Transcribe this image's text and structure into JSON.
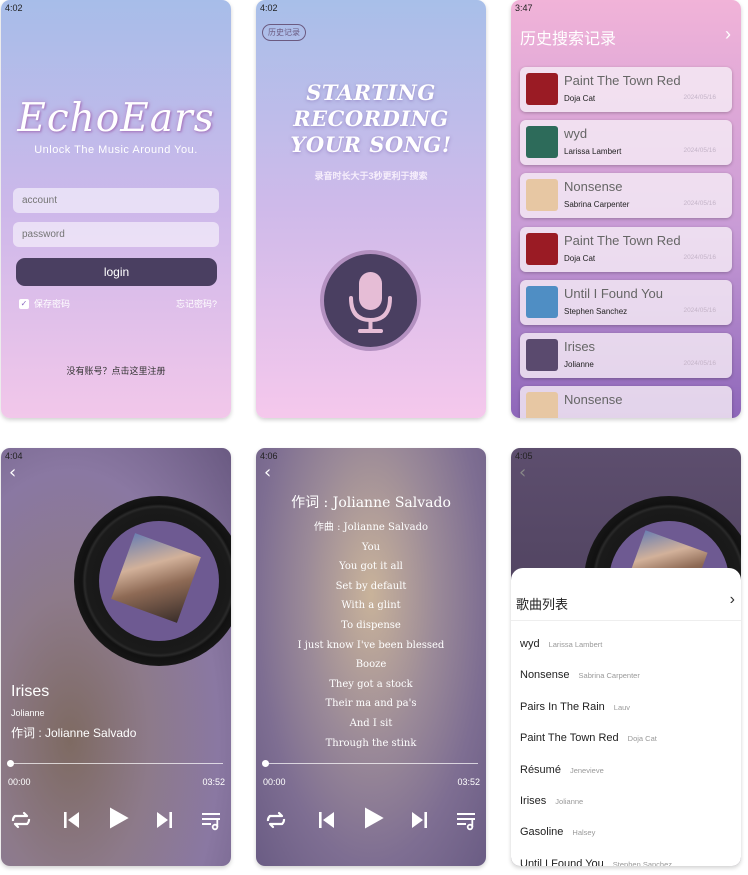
{
  "login": {
    "time": "4:02",
    "logo": "EchoEars",
    "tagline": "Unlock The Music Around You.",
    "account_placeholder": "account",
    "password_placeholder": "password",
    "login_label": "login",
    "remember": "保存密码",
    "forgot": "忘记密码?",
    "register": "没有账号？点击这里注册"
  },
  "record": {
    "time": "4:02",
    "history_button": "历史记录",
    "title_lines": [
      "STARTING",
      "RECORDING",
      "YOUR SONG!"
    ],
    "hint": "录音时长大于3秒更利于搜索",
    "mic_icon": "microphone-icon"
  },
  "history": {
    "time": "3:47",
    "title": "历史搜索记录",
    "items": [
      {
        "title": "Paint The Town Red",
        "artist": "Doja Cat",
        "date": "2024/05/16",
        "cover": "#9a1b24"
      },
      {
        "title": "wyd",
        "artist": "Larissa Lambert",
        "date": "2024/05/16",
        "cover": "#2d6b5a"
      },
      {
        "title": "Nonsense",
        "artist": "Sabrina Carpenter",
        "date": "2024/05/16",
        "cover": "#e7c7a3"
      },
      {
        "title": "Paint The Town Red",
        "artist": "Doja Cat",
        "date": "2024/05/16",
        "cover": "#9a1b24"
      },
      {
        "title": "Until I Found You",
        "artist": "Stephen Sanchez",
        "date": "2024/05/16",
        "cover": "#4f8ec4"
      },
      {
        "title": "Irises",
        "artist": "Jolianne",
        "date": "2024/05/16",
        "cover": "#5a4a6e"
      },
      {
        "title": "Nonsense",
        "artist": "",
        "date": "",
        "cover": "#e7c7a3"
      }
    ]
  },
  "player": {
    "time": "4:04",
    "song": "Irises",
    "artist": "Jolianne",
    "lyric": "作词 : Jolianne Salvado",
    "start": "00:00",
    "end": "03:52",
    "progress": 0
  },
  "lyrics": {
    "time": "4:06",
    "lines": [
      "作词 : Jolianne Salvado",
      "作曲 : Jolianne Salvado",
      "You",
      "You got it all",
      "Set by default",
      "With a glint",
      "To dispense",
      "I just know I've been blessed",
      "Booze",
      "They got a stock",
      "Their ma and pa's",
      "And I sit",
      "Through the stink"
    ],
    "start": "00:00",
    "end": "03:52"
  },
  "playlist": {
    "time": "4:05",
    "title": "歌曲列表",
    "songs": [
      {
        "title": "wyd",
        "artist": "Larissa Lambert"
      },
      {
        "title": "Nonsense",
        "artist": "Sabrina Carpenter"
      },
      {
        "title": "Pairs In The Rain",
        "artist": "Lauv"
      },
      {
        "title": "Paint The Town Red",
        "artist": "Doja Cat"
      },
      {
        "title": "Résumé",
        "artist": "Jenevieve"
      },
      {
        "title": "Irises",
        "artist": "Jolianne"
      },
      {
        "title": "Gasoline",
        "artist": "Halsey"
      },
      {
        "title": "Until I Found You",
        "artist": "Stephen Sanchez"
      }
    ]
  },
  "icons": {
    "controls": [
      "repeat-icon",
      "previous-icon",
      "play-icon",
      "next-icon",
      "playlist-icon"
    ]
  }
}
